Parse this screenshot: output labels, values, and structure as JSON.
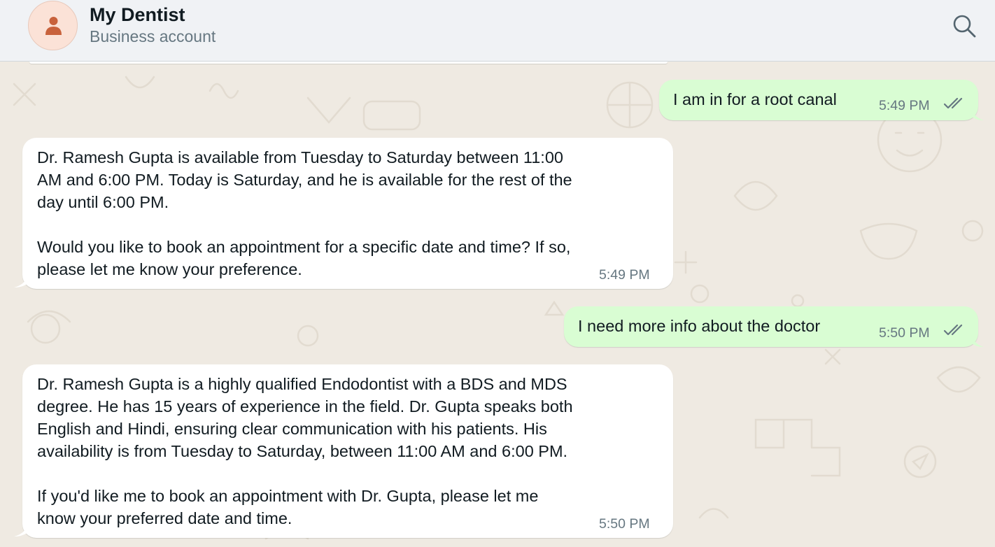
{
  "header": {
    "title": "My Dentist",
    "subtitle": "Business account",
    "avatar_icon": "person-icon",
    "search_icon": "search-icon"
  },
  "colors": {
    "outgoing_bubble": "#d9fdd3",
    "incoming_bubble": "#ffffff",
    "chat_background": "#efeae2",
    "avatar_accent": "#c8623c"
  },
  "messages": [
    {
      "direction": "outgoing",
      "text": "I am in for a root canal",
      "time": "5:49 PM",
      "status_icon": "double-check-icon"
    },
    {
      "direction": "incoming",
      "text": "Dr. Ramesh Gupta is available from Tuesday to Saturday between 11:00\nAM and 6:00 PM. Today is Saturday, and he is available for the rest of the\nday until 6:00 PM.\n\nWould you like to book an appointment for a specific date and time? If so,\nplease let me know your preference.",
      "time": "5:49 PM"
    },
    {
      "direction": "outgoing",
      "text": "I need more info about the doctor",
      "time": "5:50 PM",
      "status_icon": "double-check-icon"
    },
    {
      "direction": "incoming",
      "text": "Dr. Ramesh Gupta is a highly qualified Endodontist with a BDS and MDS\ndegree. He has 15 years of experience in the field. Dr. Gupta speaks both\nEnglish and Hindi, ensuring clear communication with his patients. His\navailability is from Tuesday to Saturday, between 11:00 AM and 6:00 PM.\n\nIf you'd like me to book an appointment with Dr. Gupta, please let me\nknow your preferred date and time.",
      "time": "5:50 PM"
    }
  ]
}
